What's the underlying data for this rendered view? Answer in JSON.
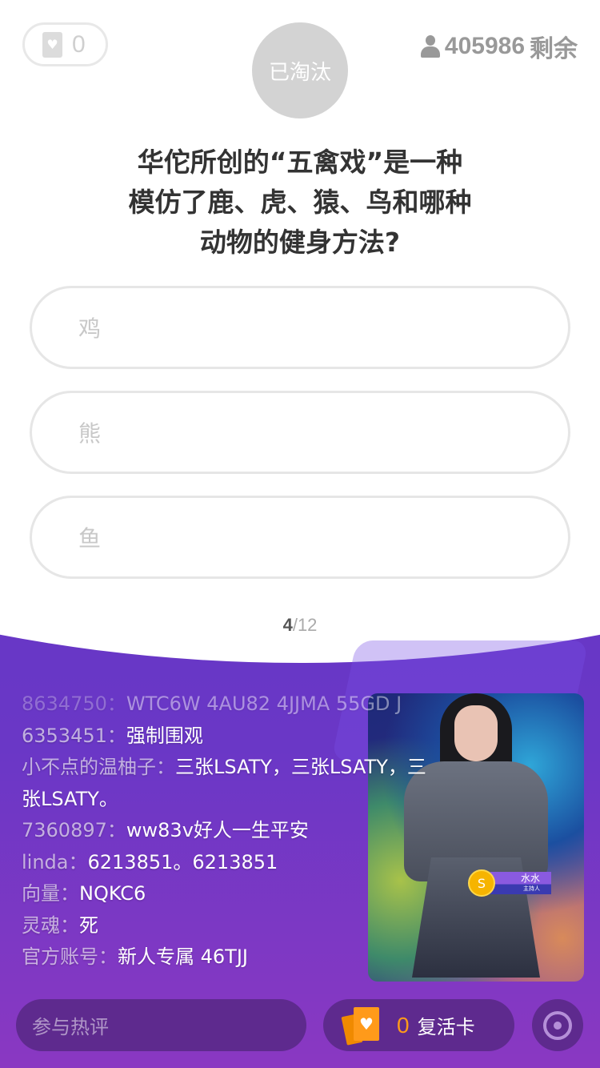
{
  "header": {
    "lives": "0",
    "status": "已淘汰",
    "remaining_count": "405986",
    "remaining_label": "剩余"
  },
  "question": {
    "lines": [
      "华佗所创的“五禽戏”是一种",
      "模仿了鹿、虎、猿、鸟和哪种",
      "动物的健身方法?"
    ]
  },
  "options": [
    "鸡",
    "熊",
    "鱼"
  ],
  "progress": {
    "current": "4",
    "total": "/12"
  },
  "chat": [
    {
      "user": "8634750：",
      "msg": "WTC6W  4AU82  4JJMA 55GD J"
    },
    {
      "user": "6353451：",
      "msg": "强制围观"
    },
    {
      "user": "小不点的温柚子：",
      "msg": "三张LSATY，三张LSATY，三张LSATY。"
    },
    {
      "user": "7360897：",
      "msg": "ww83v好人一生平安"
    },
    {
      "user": "linda：",
      "msg": "6213851。6213851"
    },
    {
      "user": "向量：",
      "msg": "NQKC6"
    },
    {
      "user": "灵魂：",
      "msg": "死"
    },
    {
      "user": "官方账号：",
      "msg": "新人专属  46TJJ"
    }
  ],
  "host": {
    "name": "水水",
    "role": "主持人"
  },
  "footer": {
    "comment_placeholder": "参与热评",
    "revive_count": "0",
    "revive_label": "复活卡"
  },
  "colors": {
    "accent": "#ff9a1a",
    "purple": "#6a37c6"
  }
}
